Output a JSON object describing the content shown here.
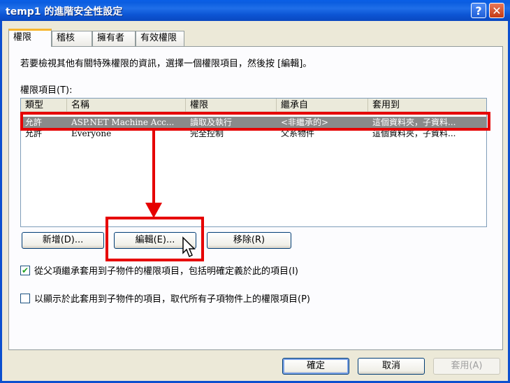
{
  "window": {
    "title": "temp1 的進階安全性設定",
    "help_glyph": "?",
    "close_glyph": "✕"
  },
  "tabs": [
    {
      "label": "權限",
      "active": true
    },
    {
      "label": "稽核",
      "active": false
    },
    {
      "label": "擁有者",
      "active": false
    },
    {
      "label": "有效權限",
      "active": false
    }
  ],
  "panel": {
    "info": "若要檢視其他有關特殊權限的資訊，選擇一個權限項目，然後按 [編輯]。",
    "entries_label": "權限項目(T):"
  },
  "listview": {
    "columns": [
      "類型",
      "名稱",
      "權限",
      "繼承自",
      "套用到"
    ],
    "rows": [
      {
        "type": "允許",
        "name": "ASP.NET Machine Acc...",
        "permission": "讀取及執行",
        "inherited": "<非繼承的>",
        "apply_to": "這個資料夾，子資料...",
        "selected": true
      },
      {
        "type": "允許",
        "name": "Everyone",
        "permission": "完全控制",
        "inherited": "父系物件",
        "apply_to": "這個資料夾，子資料...",
        "selected": false
      }
    ]
  },
  "buttons": {
    "add": "新增(D)...",
    "edit": "編輯(E)...",
    "remove": "移除(R)",
    "ok": "確定",
    "cancel": "取消",
    "apply": "套用(A)"
  },
  "checkboxes": {
    "inherit": {
      "label": "從父項繼承套用到子物件的權限項目，包括明確定義於此的項目(I)",
      "checked": true
    },
    "replace": {
      "label": "以顯示於此套用到子物件的項目，取代所有子項物件上的權限項目(P)",
      "checked": false
    }
  },
  "colors": {
    "annotation": "#e60000",
    "titlebar": "#0b5de0",
    "selection": "#8a8a8a"
  }
}
